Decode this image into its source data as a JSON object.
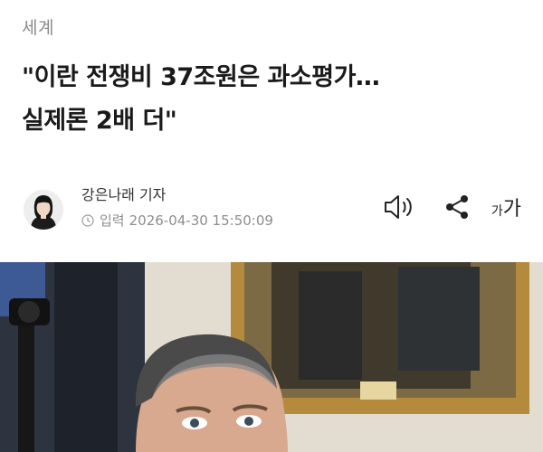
{
  "section": "세계",
  "headline": {
    "line1": "\"이란 전쟁비 37조원은 과소평가…",
    "line2": "실제론 2배 더\""
  },
  "byline": {
    "reporter": "강은나래 기자",
    "published_label": "입력",
    "published_at": "2026-04-30 15:50:09"
  },
  "tools": {
    "speaker_icon": "speaker-icon",
    "share_icon": "share-icon",
    "font_small": "가",
    "font_large": "가"
  },
  "colors": {
    "headline": "#1a1a1a",
    "meta": "#8d8d8d",
    "section": "#8a8a8a"
  }
}
